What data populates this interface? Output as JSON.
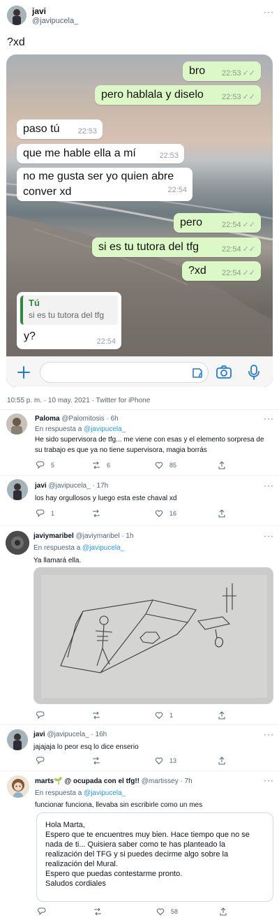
{
  "main_tweet": {
    "name": "javi",
    "handle": "@javipucela_",
    "text": "?xd",
    "meta": "10:55 p. m. · 10 may. 2021 · Twitter for iPhone"
  },
  "chat": {
    "messages": [
      {
        "text": "bro",
        "time": "22:53",
        "ticks": "✓✓"
      },
      {
        "text": "pero hablala y diselo",
        "time": "22:53",
        "ticks": "✓✓"
      },
      {
        "text": "paso tú",
        "time": "22:53"
      },
      {
        "text": "que me hable ella a mí",
        "time": "22:53"
      },
      {
        "line1": "no me gusta ser yo quien abre",
        "line2": "conver xd",
        "time": "22:54"
      },
      {
        "text": "pero",
        "time": "22:54",
        "ticks": "✓✓"
      },
      {
        "text": "si es tu tutora del tfg",
        "time": "22:54",
        "ticks": "✓✓"
      },
      {
        "text": "?xd",
        "time": "22:54",
        "ticks": "✓✓"
      }
    ],
    "reply": {
      "quote_author": "Tú",
      "quote_text": "si es tu tutora del tfg",
      "text": "y?",
      "time": "22:54"
    },
    "icons": [
      "plus-icon",
      "sticker-icon",
      "camera-icon",
      "microphone-icon"
    ]
  },
  "replies": [
    {
      "name": "Paloma",
      "handle": "@Palomitosis",
      "time": "· 6h",
      "in_reply_prefix": "En respuesta a",
      "in_reply_handle": "@javipucela_",
      "line1": "He sido supervisora de tfg... me viene con esas y el elemento sorpresa de",
      "line2": "su trabajo es que ya no tiene supervisora, magia borrás",
      "replies": "5",
      "retweets": "6",
      "likes": "85"
    },
    {
      "name": "javi",
      "handle": "@javipucela_",
      "time": "· 17h",
      "line1": "los hay orgullosos y luego esta este chaval xd",
      "replies": "1",
      "retweets": "",
      "likes": "16"
    },
    {
      "name": "javiymaribel",
      "handle": "@javiymaribel",
      "time": "· 1h",
      "in_reply_prefix": "En respuesta a",
      "in_reply_handle": "@javipucela_",
      "line1": "Ya llamará ella.",
      "replies": "",
      "retweets": "",
      "likes": "1"
    },
    {
      "name": "javi",
      "handle": "@javipucela_",
      "time": "· 16h",
      "line1": "jajajaja lo peor esq lo dice enserio",
      "replies": "",
      "retweets": "",
      "likes": "13"
    },
    {
      "name": "marts🌱 @ ocupada con el tfg!!",
      "handle": "@martissey",
      "time": "· 7h",
      "in_reply_prefix": "En respuesta a",
      "in_reply_handle": "@javipucela_",
      "line1": "funcionar funciona, llevaba sin escribirle como un mes",
      "replies": "",
      "retweets": "",
      "likes": "58"
    }
  ],
  "letter": {
    "lines": [
      "Hola Marta,",
      "Espero que te encuentres muy bien. Hace tiempo que no se",
      "nada de ti... Quisiera saber como te has planteado la",
      "realización del TFG y si puedes decirme algo sobre la",
      "realización del Mural.",
      "Espero que puedas contestarme pronto.",
      "Saludos cordiales"
    ]
  },
  "more_menu": "···"
}
